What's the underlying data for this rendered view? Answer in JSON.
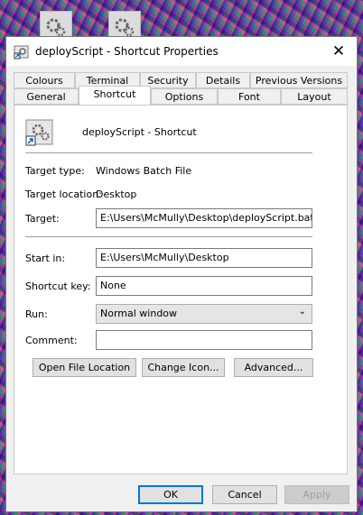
{
  "window": {
    "title": "deployScript - Shortcut Properties",
    "close_glyph": "✕"
  },
  "tabs_row1": [
    "Colours",
    "Terminal",
    "Security",
    "Details",
    "Previous Versions"
  ],
  "tabs_row2": [
    "General",
    "Shortcut",
    "Options",
    "Font",
    "Layout"
  ],
  "active_tab": "Shortcut",
  "shortcut": {
    "name": "deployScript - Shortcut",
    "target_type_label": "Target type:",
    "target_type_value": "Windows Batch File",
    "target_location_label": "Target location:",
    "target_location_value": "Desktop",
    "target_label": "Target:",
    "target_value": "E:\\Users\\McMully\\Desktop\\deployScript.bat",
    "start_in_label": "Start in:",
    "start_in_value": "E:\\Users\\McMully\\Desktop",
    "shortcut_key_label": "Shortcut key:",
    "shortcut_key_value": "None",
    "run_label": "Run:",
    "run_value": "Normal window",
    "comment_label": "Comment:",
    "comment_value": ""
  },
  "buttons": {
    "open_file_location": "Open File Location",
    "change_icon": "Change Icon...",
    "advanced": "Advanced...",
    "ok": "OK",
    "cancel": "Cancel",
    "apply": "Apply"
  },
  "icons": {
    "gear": "gear-icon",
    "shortcut_arrow": "shortcut-arrow-icon"
  }
}
